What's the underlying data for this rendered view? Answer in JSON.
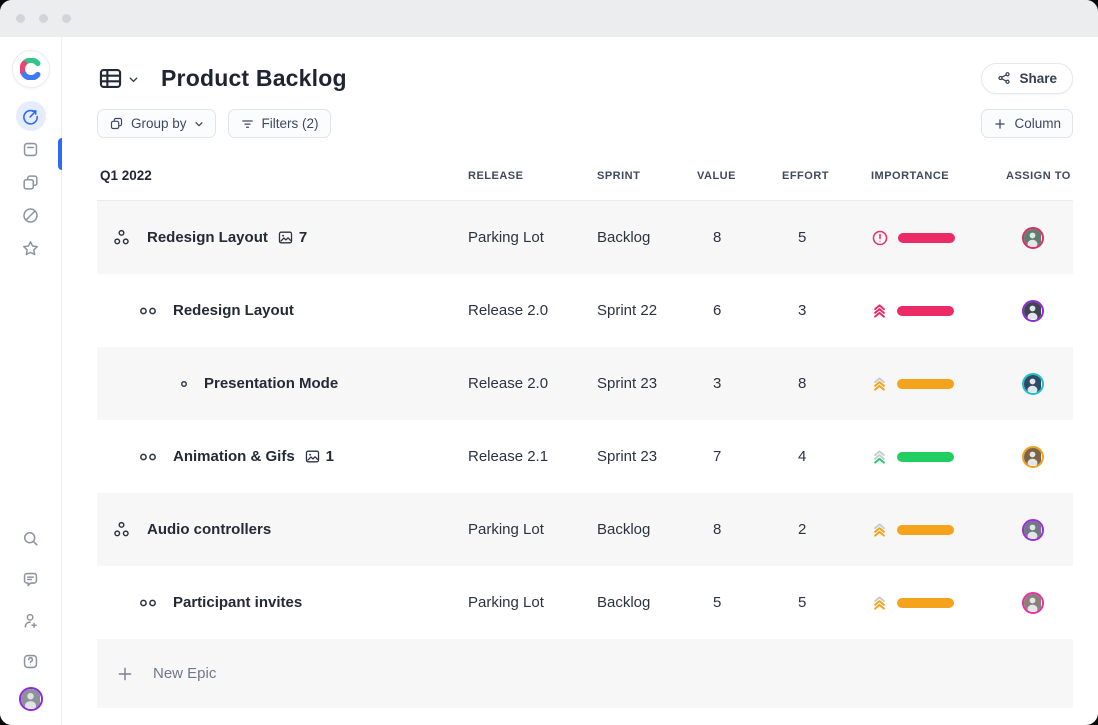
{
  "header": {
    "title": "Product Backlog",
    "share_label": "Share"
  },
  "toolbar": {
    "group_by_label": "Group by",
    "filters_label": "Filters (2)",
    "add_column_label": "Column"
  },
  "table": {
    "group_label": "Q1 2022",
    "columns": [
      "RELEASE",
      "SPRINT",
      "VALUE",
      "EFFORT",
      "IMPORTANCE",
      "ASSIGN TO"
    ],
    "rows": [
      {
        "name": "Redesign Layout",
        "kind": "epic",
        "attachments": "7",
        "release": "Parking Lot",
        "sprint": "Backlog",
        "value": "8",
        "effort": "5",
        "importance": {
          "type": "alert",
          "color": "#EC2A66",
          "bar_color": "#EC2A66"
        },
        "assignee": {
          "ring": "#DB2E66",
          "bg": "#5f7d6e"
        }
      },
      {
        "name": "Redesign Layout",
        "kind": "story",
        "release": "Release 2.0",
        "sprint": "Sprint 22",
        "value": "6",
        "effort": "3",
        "importance": {
          "type": "chevrons",
          "chevrons": [
            "#EC2A66",
            "#EC2A66",
            "#EC2A66"
          ],
          "bar_color": "#EC2A66"
        },
        "assignee": {
          "ring": "#8E2BD6",
          "bg": "#3f4651"
        }
      },
      {
        "name": "Presentation Mode",
        "kind": "substory",
        "release": "Release 2.0",
        "sprint": "Sprint 23",
        "value": "3",
        "effort": "8",
        "importance": {
          "type": "chevrons",
          "chevrons": [
            "#C9CCD2",
            "#F5A31C",
            "#F5A31C"
          ],
          "bar_color": "#F5A31C"
        },
        "assignee": {
          "ring": "#1FC2CC",
          "bg": "#2f4a66"
        }
      },
      {
        "name": "Animation & Gifs",
        "kind": "story",
        "attachments": "1",
        "release": "Release 2.1",
        "sprint": "Sprint 23",
        "value": "7",
        "effort": "4",
        "importance": {
          "type": "chevrons",
          "chevrons": [
            "#C9CCD2",
            "#C9CCD2",
            "#21CE61"
          ],
          "bar_color": "#21CE61"
        },
        "assignee": {
          "ring": "#F0A21E",
          "bg": "#7d6246"
        }
      },
      {
        "name": "Audio controllers",
        "kind": "epic",
        "release": "Parking Lot",
        "sprint": "Backlog",
        "value": "8",
        "effort": "2",
        "importance": {
          "type": "chevrons",
          "chevrons": [
            "#C9CCD2",
            "#F5A31C",
            "#F5A31C"
          ],
          "bar_color": "#F5A31C"
        },
        "assignee": {
          "ring": "#9D2BDB",
          "bg": "#717784"
        }
      },
      {
        "name": "Participant invites",
        "kind": "story",
        "release": "Parking Lot",
        "sprint": "Backlog",
        "value": "5",
        "effort": "5",
        "importance": {
          "type": "chevrons",
          "chevrons": [
            "#C9CCD2",
            "#F5A31C",
            "#F5A31C"
          ],
          "bar_color": "#F5A31C"
        },
        "assignee": {
          "ring": "#EA2FA6",
          "bg": "#8a8276"
        }
      }
    ],
    "new_epic_label": "New Epic"
  },
  "colors": {
    "accent_blue": "#2D6BF6",
    "pink": "#EC2A66",
    "orange": "#F5A31C",
    "green": "#21CE61",
    "chevron_gray": "#C9CCD2",
    "row_alt_bg": "#F7F7F8"
  }
}
